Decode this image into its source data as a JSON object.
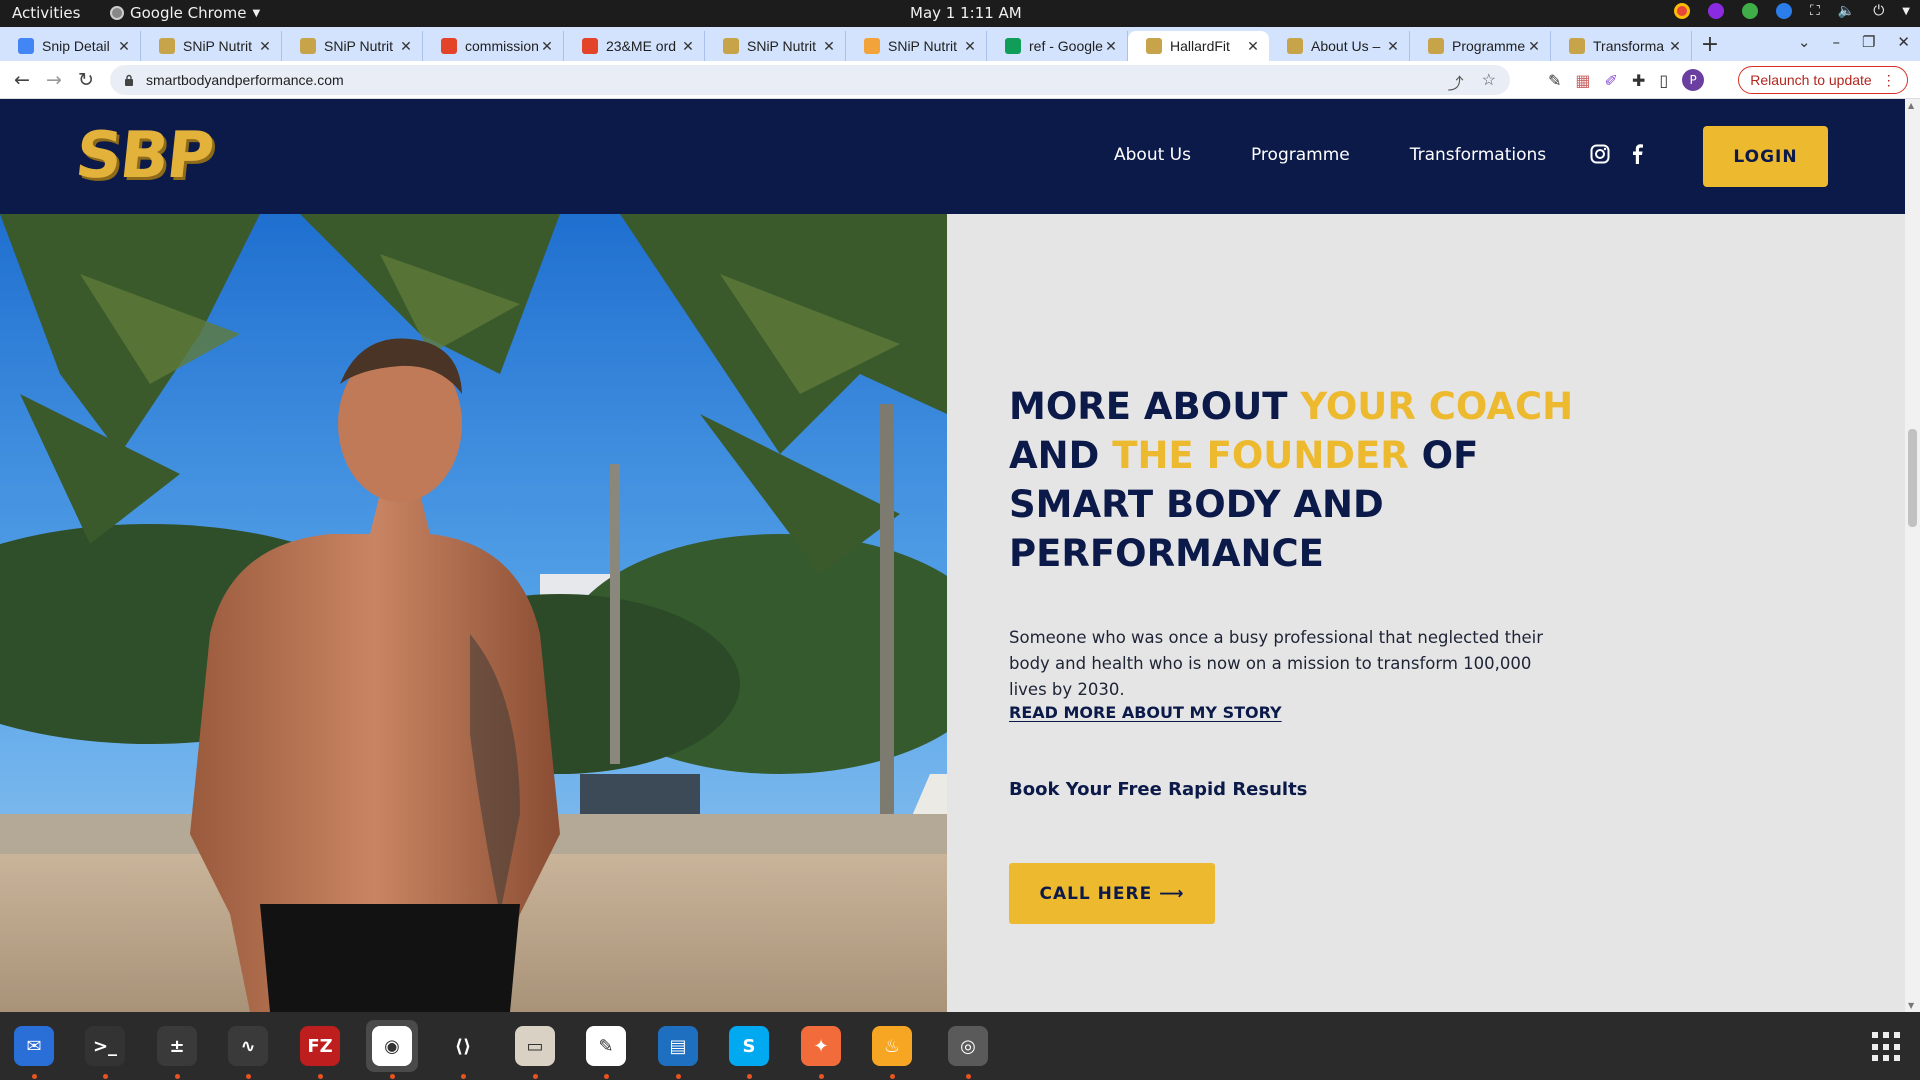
{
  "system": {
    "activities": "Activities",
    "app_name": "Google Chrome",
    "clock": "May 1  1:11 AM"
  },
  "tabs": [
    {
      "title": "Snip Detail",
      "favicon_color": "#4285f4",
      "active": false
    },
    {
      "title": "SNiP Nutrit",
      "favicon_color": "#c7a34a",
      "active": false
    },
    {
      "title": "SNiP Nutrit",
      "favicon_color": "#c7a34a",
      "active": false
    },
    {
      "title": "commission",
      "favicon_color": "#e24329",
      "active": false
    },
    {
      "title": "23&ME ord",
      "favicon_color": "#e24329",
      "active": false
    },
    {
      "title": "SNiP Nutrit",
      "favicon_color": "#c7a34a",
      "active": false
    },
    {
      "title": "SNiP Nutrit",
      "favicon_color": "#f2a33a",
      "active": false
    },
    {
      "title": "ref - Google",
      "favicon_color": "#0f9d58",
      "active": false
    },
    {
      "title": "HallardFit",
      "favicon_color": "#c7a34a",
      "active": true
    },
    {
      "title": "About Us –",
      "favicon_color": "#c7a34a",
      "active": false
    },
    {
      "title": "Programme",
      "favicon_color": "#c7a34a",
      "active": false
    },
    {
      "title": "Transforma",
      "favicon_color": "#c7a34a",
      "active": false
    }
  ],
  "toolbar": {
    "url": "smartbodyandperformance.com",
    "relaunch_label": "Relaunch to update",
    "profile_initial": "P"
  },
  "site": {
    "logo_text": "SBP",
    "nav": [
      "About Us",
      "Programme",
      "Transformations"
    ],
    "login_label": "LOGIN",
    "headline": {
      "part1": "MORE ABOUT ",
      "accent1": "YOUR COACH",
      "part2": " AND ",
      "accent2": "THE FOUNDER",
      "part3": " OF SMART BODY AND PERFORMANCE"
    },
    "intro": "Someone who was once a busy professional that neglected their body and health who is now on a mission to transform 100,000 lives by 2030.",
    "read_more": "READ MORE ABOUT MY STORY",
    "book_text": "Book Your Free Rapid Results",
    "call_label": "CALL HERE ⟶"
  },
  "colors": {
    "navy": "#0c1a4a",
    "gold": "#edb92e",
    "content_bg": "#e5e5e5"
  },
  "dock": [
    {
      "name": "thunderbird",
      "color": "#2a6ed8"
    },
    {
      "name": "terminal",
      "color": "#333333"
    },
    {
      "name": "calculator",
      "color": "#3a3a3a"
    },
    {
      "name": "system-monitor",
      "color": "#3a3a3a"
    },
    {
      "name": "filezilla",
      "color": "#bf1e1e"
    },
    {
      "name": "chrome",
      "color": "#ffffff"
    },
    {
      "name": "vscode",
      "color": "#2b2b2b"
    },
    {
      "name": "files",
      "color": "#d9d2c4"
    },
    {
      "name": "text-editor",
      "color": "#ffffff"
    },
    {
      "name": "writer",
      "color": "#1e6fbf"
    },
    {
      "name": "skype",
      "color": "#00a9f0"
    },
    {
      "name": "postman",
      "color": "#f26b3a"
    },
    {
      "name": "firefly",
      "color": "#f6a623"
    },
    {
      "name": "disk",
      "color": "#5a5a5a"
    }
  ]
}
